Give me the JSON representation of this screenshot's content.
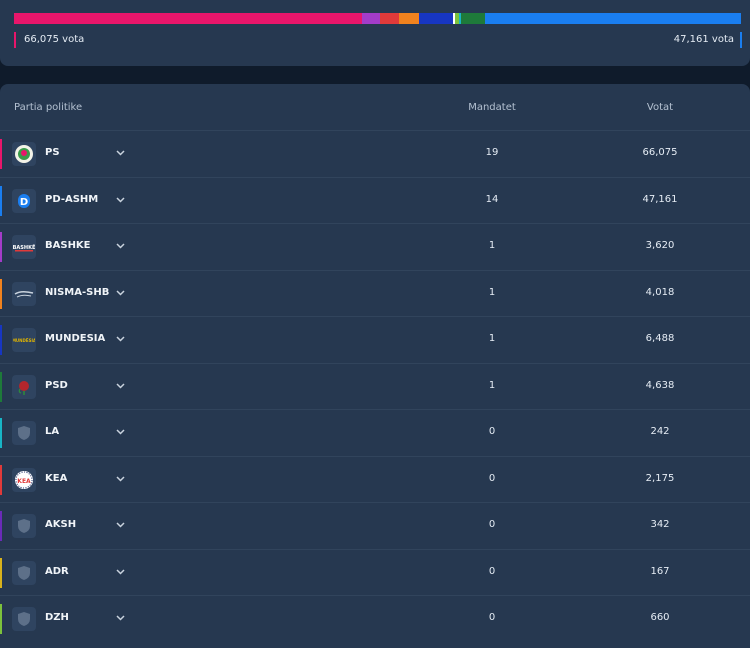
{
  "summary": {
    "left_votes": "66,075 vota",
    "right_votes": "47,161 vota",
    "bar_segments": [
      {
        "party": "PS",
        "seats": 19,
        "color": "#e8166b"
      },
      {
        "party": "BASHKE",
        "seats": 1,
        "color": "#a33cc9"
      },
      {
        "party": "KEA",
        "seats": 1,
        "color": "#e03a3a"
      },
      {
        "party": "NISMA-SHB",
        "seats": 1.1,
        "color": "#f0821e"
      },
      {
        "party": "MUNDESIA",
        "seats": 1.9,
        "color": "#1736c2"
      },
      {
        "party": "gap",
        "seats": 0.1,
        "color": "#ffffff"
      },
      {
        "party": "DZH",
        "seats": 0.2,
        "color": "#7cc23c"
      },
      {
        "party": "LA",
        "seats": 0.1,
        "color": "#18b5c6"
      },
      {
        "party": "PSD",
        "seats": 1.3,
        "color": "#1e7a3a"
      },
      {
        "party": "PD-ASHM",
        "seats": 14,
        "color": "#1a7ef0"
      }
    ]
  },
  "table": {
    "headers": {
      "party": "Partia politike",
      "seats": "Mandatet",
      "votes": "Votat"
    },
    "rows": [
      {
        "name": "PS",
        "seats": "19",
        "votes": "66,075",
        "color": "#e8166b",
        "logo": "ps-logo"
      },
      {
        "name": "PD-ASHM",
        "seats": "14",
        "votes": "47,161",
        "color": "#1a7ef0",
        "logo": "pd-logo"
      },
      {
        "name": "BASHKE",
        "seats": "1",
        "votes": "3,620",
        "color": "#a33cc9",
        "logo": "bashke-logo"
      },
      {
        "name": "NISMA-SHB",
        "seats": "1",
        "votes": "4,018",
        "color": "#f0821e",
        "logo": "nisma-logo"
      },
      {
        "name": "MUNDESIA",
        "seats": "1",
        "votes": "6,488",
        "color": "#1736c2",
        "logo": "mundesia-logo"
      },
      {
        "name": "PSD",
        "seats": "1",
        "votes": "4,638",
        "color": "#1e7a3a",
        "logo": "psd-logo"
      },
      {
        "name": "LA",
        "seats": "0",
        "votes": "242",
        "color": "#18b5c6",
        "logo": "shield-placeholder-icon"
      },
      {
        "name": "KEA",
        "seats": "0",
        "votes": "2,175",
        "color": "#e03a3a",
        "logo": "kea-logo"
      },
      {
        "name": "AKSH",
        "seats": "0",
        "votes": "342",
        "color": "#6a2bb8",
        "logo": "shield-placeholder-icon"
      },
      {
        "name": "ADR",
        "seats": "0",
        "votes": "167",
        "color": "#d8b21c",
        "logo": "shield-placeholder-icon"
      },
      {
        "name": "DZH",
        "seats": "0",
        "votes": "660",
        "color": "#7cc23c",
        "logo": "shield-placeholder-icon"
      }
    ]
  }
}
